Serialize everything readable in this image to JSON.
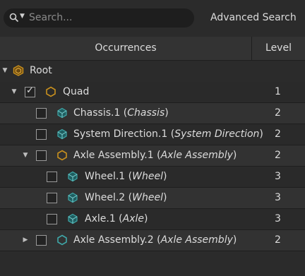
{
  "search": {
    "placeholder": "Search..."
  },
  "advanced_search_label": "Advanced Search",
  "columns": {
    "occurrences": "Occurrences",
    "level": "Level"
  },
  "root": {
    "label": "Root"
  },
  "rows": [
    {
      "name": "Quad",
      "type": "",
      "level": "1",
      "checked": true,
      "icon": "assembly-icon"
    },
    {
      "name": "Chassis.1",
      "type": "Chassis",
      "level": "2",
      "checked": false,
      "icon": "part-icon"
    },
    {
      "name": "System Direction.1",
      "type": "System Direction",
      "level": "2",
      "checked": false,
      "icon": "part-icon"
    },
    {
      "name": "Axle Assembly.1",
      "type": "Axle Assembly",
      "level": "2",
      "checked": false,
      "icon": "assembly-icon"
    },
    {
      "name": "Wheel.1",
      "type": "Wheel",
      "level": "3",
      "checked": false,
      "icon": "part-icon"
    },
    {
      "name": "Wheel.2",
      "type": "Wheel",
      "level": "3",
      "checked": false,
      "icon": "part-icon"
    },
    {
      "name": "Axle.1",
      "type": "Axle",
      "level": "3",
      "checked": false,
      "icon": "part-icon"
    },
    {
      "name": "Axle Assembly.2",
      "type": "Axle Assembly",
      "level": "2",
      "checked": false,
      "icon": "assembly-icon"
    }
  ],
  "colors": {
    "assembly": "#c8901e",
    "part": "#3fa7a8",
    "background": "#2b2b2b"
  }
}
